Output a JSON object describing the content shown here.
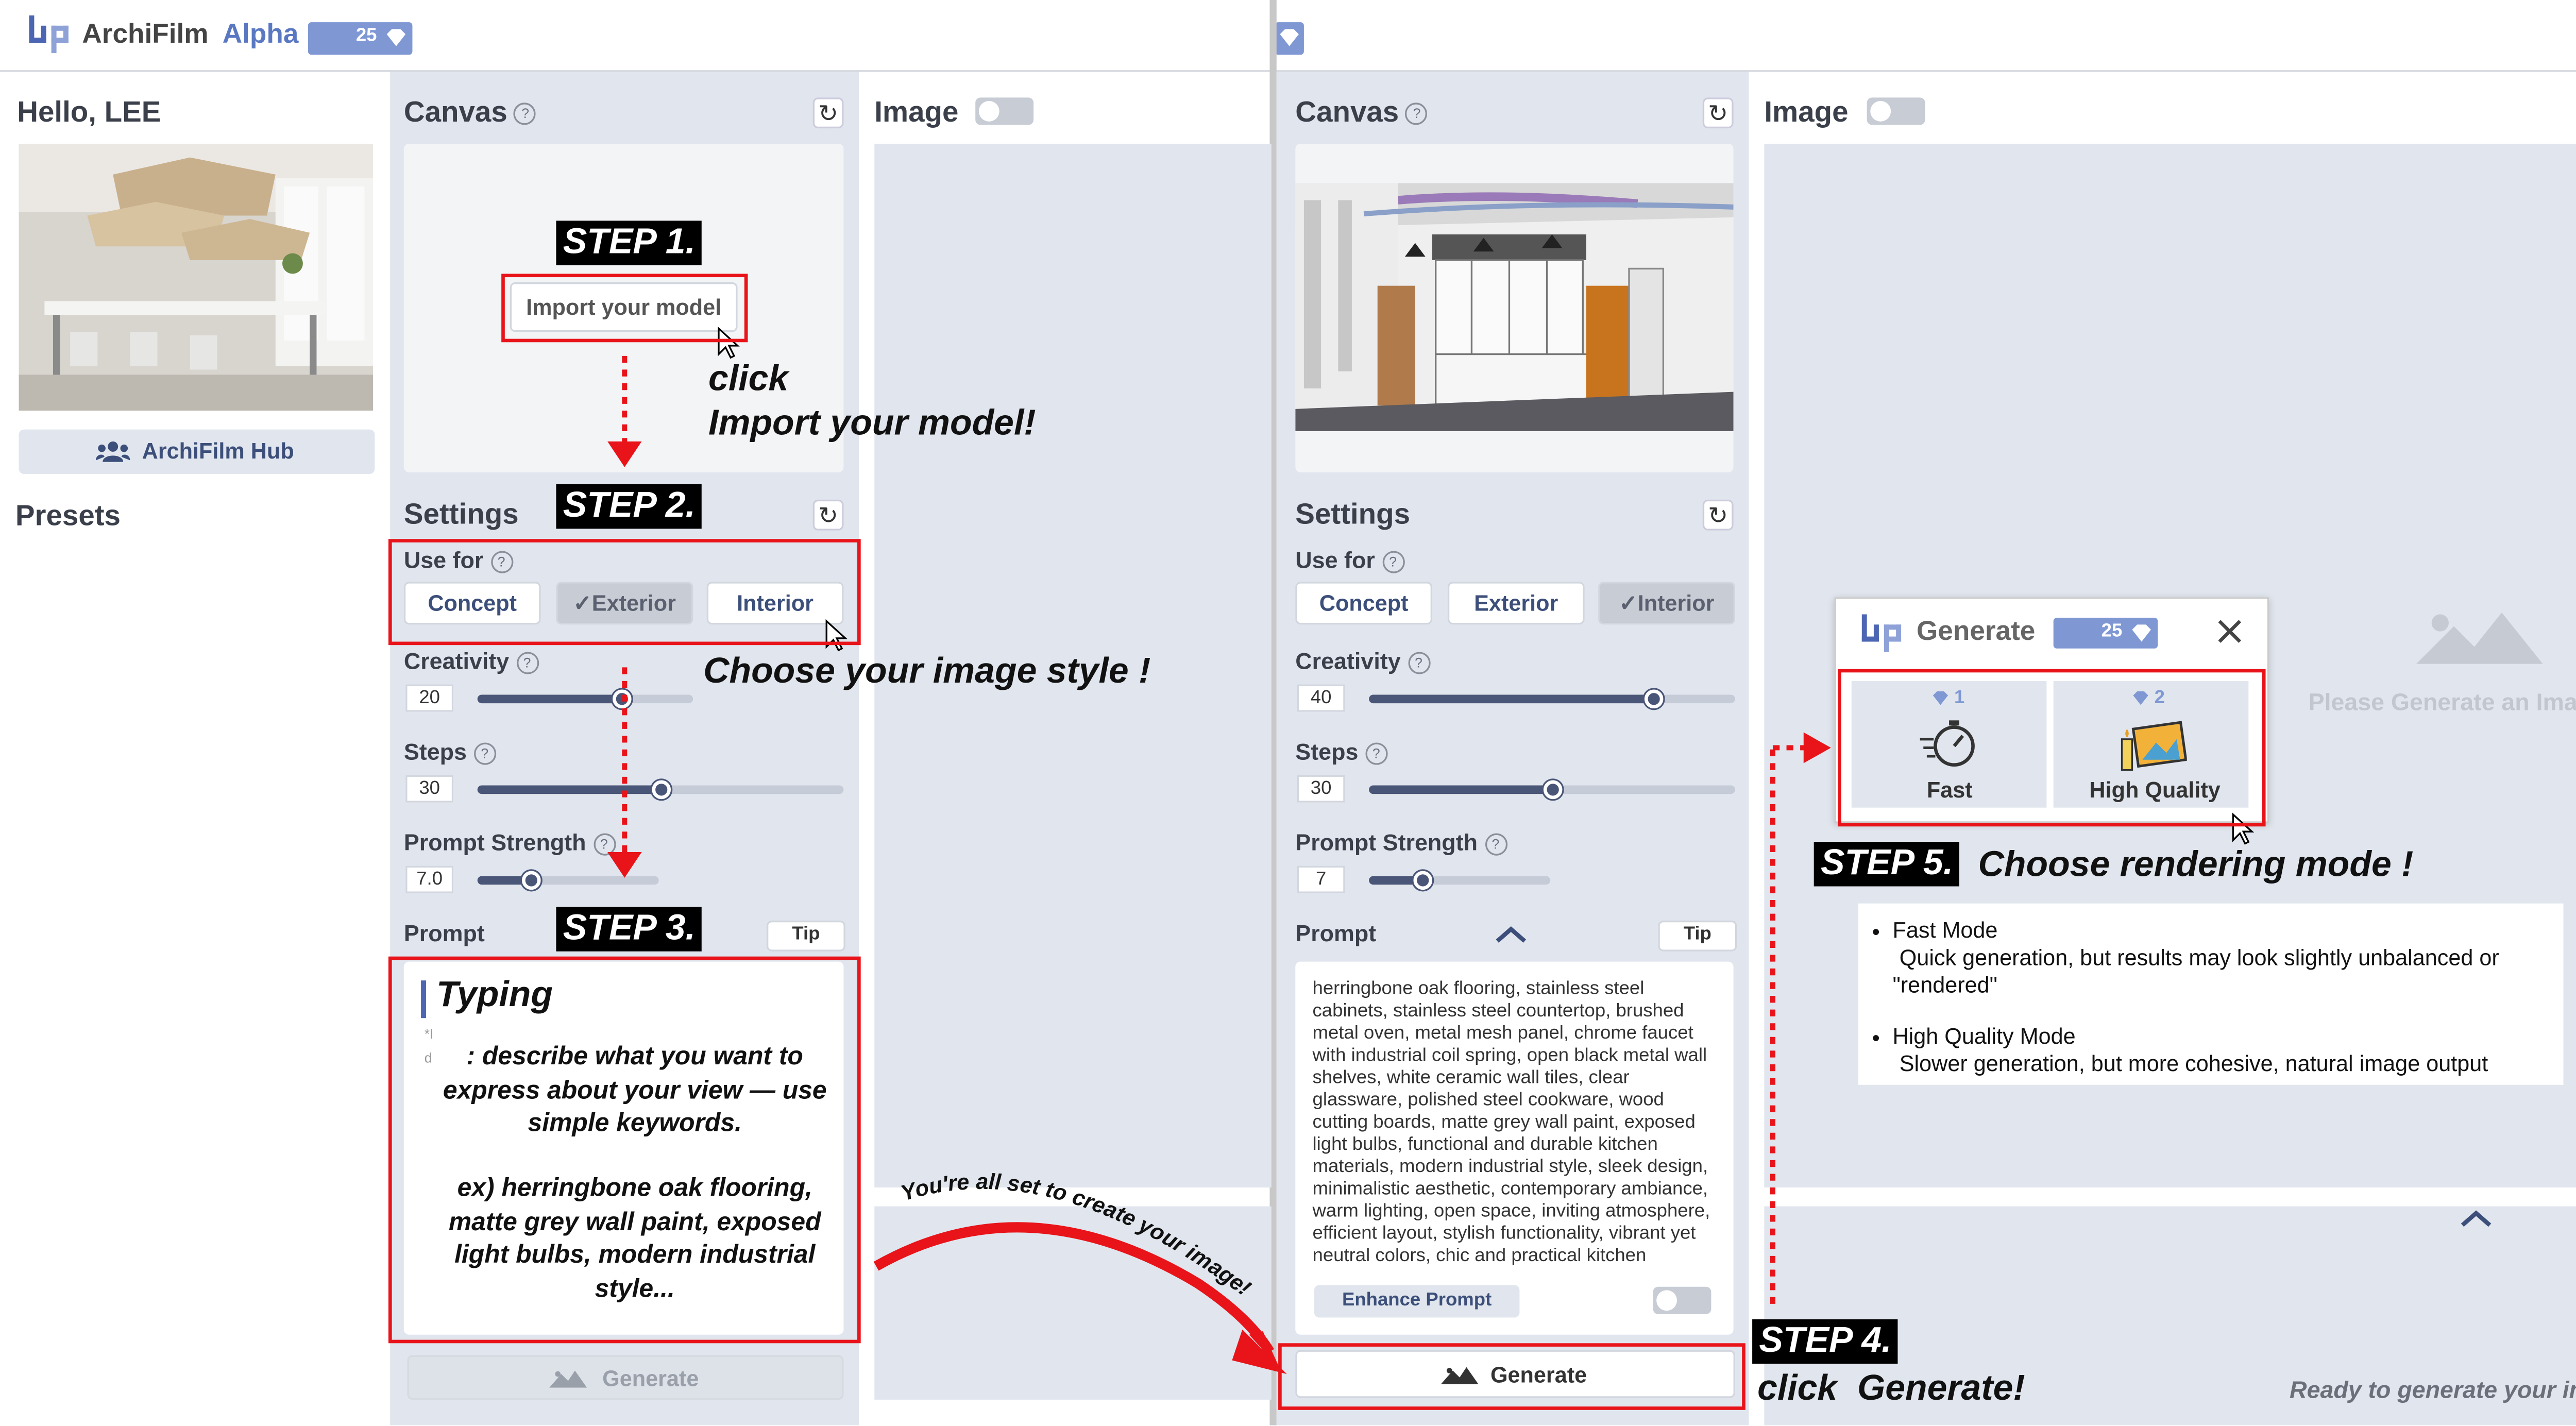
{
  "app": {
    "name": "ArchiFilm",
    "version": "Alpha",
    "credits": "25"
  },
  "left": {
    "greeting": "Hello, LEE",
    "hub_label": "ArchiFilm Hub",
    "presets_title": "Presets",
    "canvas_title": "Canvas",
    "import_label": "Import your model",
    "settings_title": "Settings",
    "use_for_label": "Use for",
    "use_for_options": [
      "Concept",
      "Exterior",
      "Interior"
    ],
    "use_for_selected": "Exterior",
    "creativity_label": "Creativity",
    "creativity_value": "20",
    "creativity_fraction": 0.67,
    "steps_label": "Steps",
    "steps_value": "30",
    "steps_fraction": 0.5,
    "prompt_strength_label": "Prompt Strength",
    "prompt_strength_value": "7.0",
    "prompt_strength_fraction": 0.3,
    "prompt_label": "Prompt",
    "tip_label": "Tip",
    "generate_label": "Generate",
    "image_title": "Image"
  },
  "right": {
    "canvas_title": "Canvas",
    "settings_title": "Settings",
    "use_for_label": "Use for",
    "use_for_options": [
      "Concept",
      "Exterior",
      "Interior"
    ],
    "use_for_selected": "Interior",
    "creativity_label": "Creativity",
    "creativity_value": "40",
    "creativity_fraction": 0.78,
    "steps_label": "Steps",
    "steps_value": "30",
    "steps_fraction": 0.5,
    "prompt_strength_label": "Prompt Strength",
    "prompt_strength_value": "7",
    "prompt_strength_fraction": 0.3,
    "prompt_label": "Prompt",
    "tip_label": "Tip",
    "prompt_text": "herringbone oak flooring, stainless steel cabinets, stainless steel countertop, brushed metal oven, metal mesh panel, chrome faucet with industrial coil spring, open black metal wall shelves, white ceramic wall tiles, clear glassware, polished steel cookware, wood cutting boards, matte grey wall paint,  exposed light bulbs, functional and durable kitchen materials, modern industrial style, sleek design, minimalistic aesthetic, contemporary ambiance, warm lighting, open space, inviting atmosphere, efficient layout, stylish functionality, vibrant yet neutral colors, chic and practical kitchen",
    "enhance_label": "Enhance Prompt",
    "generate_label": "Generate",
    "image_title": "Image",
    "placeholder_text": "Please Generate an Image :)",
    "ready_text": "Ready to generate your image?"
  },
  "modal": {
    "title": "Generate",
    "credits": "25",
    "options": [
      {
        "label": "Fast",
        "cost": "1"
      },
      {
        "label": "High Quality",
        "cost": "2"
      }
    ]
  },
  "annotations": {
    "step1": "STEP 1.",
    "step1_text_1": "click",
    "step1_text_2": "Import your model!",
    "step2": "STEP 2.",
    "step2_text": "Choose your image style !",
    "step3": "STEP 3.",
    "typing": "Typing",
    "typing_desc": ": describe what you want to express about your view — use simple keywords.",
    "typing_example": "ex) herringbone oak flooring, matte grey wall paint, exposed light bulbs, modern industrial style...",
    "arc_text": "You're all set to create your image!",
    "step4": "STEP 4.",
    "step4_text": "click  Generate!",
    "step5": "STEP 5.",
    "step5_text": "Choose rendering mode !",
    "modes": [
      {
        "title": "Fast Mode",
        "desc": "Quick generation, but results may look slightly unbalanced or \"rendered\""
      },
      {
        "title": "High Quality Mode",
        "desc": "Slower generation, but more cohesive, natural image output"
      }
    ]
  },
  "colors": {
    "accent": "#3c4f7a",
    "badge": "#7f98d4",
    "panel": "#e1e6ee",
    "annotation_red": "#e8141a"
  },
  "icons": [
    "logo-icon",
    "gem-icon",
    "help-icon",
    "refresh-icon",
    "users-icon",
    "check-icon",
    "mountain-icon",
    "chevron-up-icon",
    "close-icon",
    "stopwatch-icon",
    "image-quality-icon",
    "cursor-icon"
  ]
}
